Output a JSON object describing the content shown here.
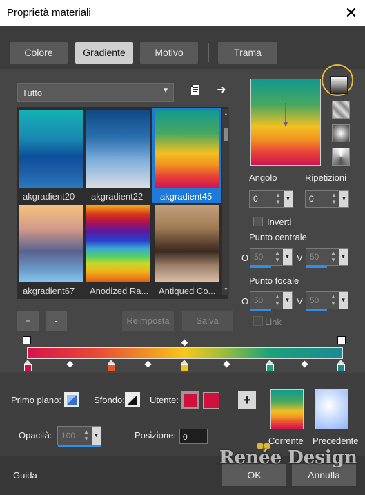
{
  "window": {
    "title": "Proprietà materiali",
    "close": "✕"
  },
  "tabs": [
    {
      "label": "Colore"
    },
    {
      "label": "Gradiente"
    },
    {
      "label": "Motivo"
    },
    {
      "label": "Trama"
    }
  ],
  "filter": {
    "value": "Tutto"
  },
  "gallery": {
    "items": [
      {
        "label": "akgradient20"
      },
      {
        "label": "akgradient22"
      },
      {
        "label": "akgradient45"
      },
      {
        "label": "akgradient67"
      },
      {
        "label": "Anodized Ra..."
      },
      {
        "label": "Antiqued Co..."
      }
    ]
  },
  "buttons": {
    "add": "+",
    "remove": "-",
    "reset": "Reimposta",
    "save": "Salva"
  },
  "controls": {
    "angle_label": "Angolo",
    "angle_value": "0",
    "repeat_label": "Ripetizioni",
    "repeat_value": "0",
    "invert_label": "Inverti",
    "center_label": "Punto centrale",
    "center_o_label": "O",
    "center_o": "50",
    "center_v_label": "V",
    "center_v": "50",
    "focal_label": "Punto focale",
    "focal_o_label": "O",
    "focal_o": "50",
    "focal_v_label": "V",
    "focal_v": "50",
    "link_label": "Link"
  },
  "bottom": {
    "foreground_label": "Primo piano:",
    "background_label": "Sfondo:",
    "user_label": "Utente:",
    "opacity_label": "Opacità:",
    "opacity_value": "100",
    "position_label": "Posizione:",
    "position_value": "0",
    "plus": "+",
    "current_label": "Corrente",
    "previous_label": "Precedente"
  },
  "footer": {
    "help": "Guida",
    "ok": "OK",
    "cancel": "Annulla",
    "watermark": "Renée Design"
  },
  "colors": {
    "user_color_1": "#d0103f",
    "user_color_2": "#d0103f",
    "accent": "#1e7ad8",
    "highlight_ring": "#e6b93a"
  }
}
